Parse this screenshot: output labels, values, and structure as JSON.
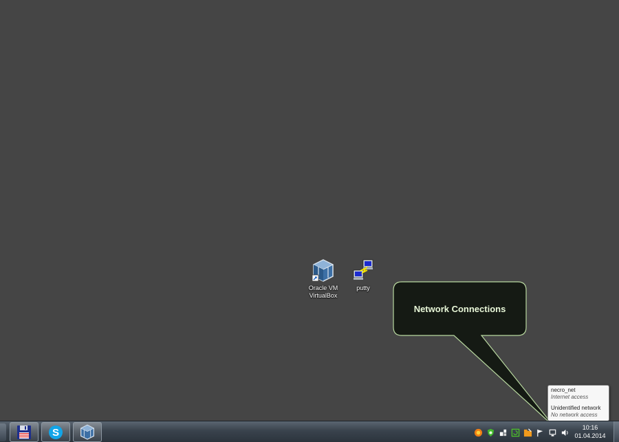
{
  "desktop": {
    "icons": [
      {
        "label": "Oracle VM VirtualBox",
        "icon": "virtualbox-icon"
      },
      {
        "label": "putty",
        "icon": "putty-icon"
      }
    ]
  },
  "callout": {
    "text": "Network Connections",
    "fill": "#151a14",
    "border": "#b9d9a0",
    "text_color": "#e8f7d8"
  },
  "network_popup": {
    "connections": [
      {
        "name": "necro_net",
        "status": "Internet access"
      },
      {
        "name": "Unidentified network",
        "status": "No network access"
      }
    ]
  },
  "taskbar": {
    "pinned": [
      {
        "name": "save-disk",
        "icon": "floppy-disk-icon"
      },
      {
        "name": "skype",
        "icon": "skype-icon"
      },
      {
        "name": "virtualbox",
        "icon": "virtualbox-icon"
      }
    ],
    "tray_icons": [
      "avast-icon",
      "green-shield-icon",
      "usb-device-icon",
      "refresh-icon",
      "folder-sync-icon",
      "action-center-flag-icon",
      "network-icon",
      "volume-icon"
    ],
    "clock": {
      "time": "10:16",
      "date": "01.04.2014"
    }
  },
  "colors": {
    "desktop_bg": "#454545",
    "taskbar_bg": "#3a434d"
  }
}
